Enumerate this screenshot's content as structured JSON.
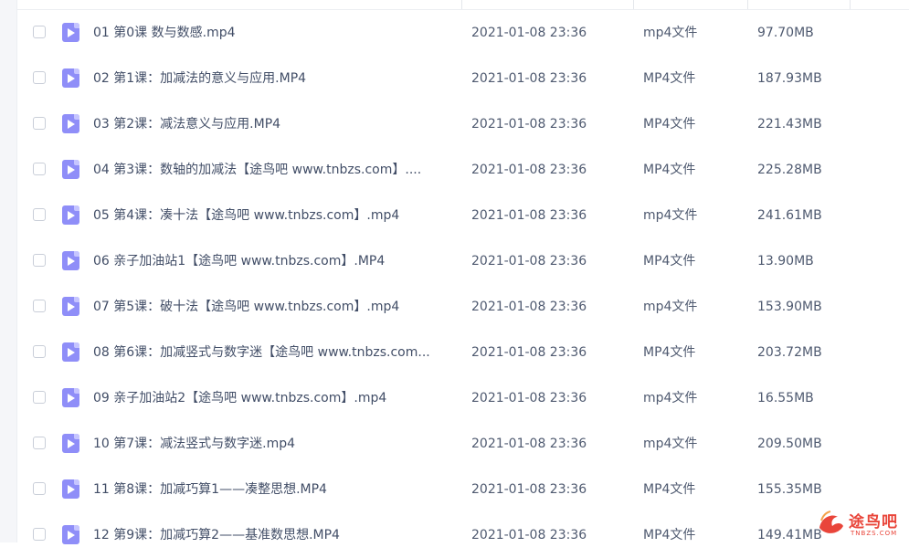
{
  "files": [
    {
      "name": "01 第0课 数与数感.mp4",
      "date": "2021-01-08 23:36",
      "type": "mp4文件",
      "size": "97.70MB"
    },
    {
      "name": "02 第1课：加减法的意义与应用.MP4",
      "date": "2021-01-08 23:36",
      "type": "MP4文件",
      "size": "187.93MB"
    },
    {
      "name": "03 第2课：减法意义与应用.MP4",
      "date": "2021-01-08 23:36",
      "type": "MP4文件",
      "size": "221.43MB"
    },
    {
      "name": "04 第3课：数轴的加减法【途鸟吧 www.tnbzs.com】....",
      "date": "2021-01-08 23:36",
      "type": "MP4文件",
      "size": "225.28MB"
    },
    {
      "name": "05 第4课：凑十法【途鸟吧 www.tnbzs.com】.mp4",
      "date": "2021-01-08 23:36",
      "type": "mp4文件",
      "size": "241.61MB"
    },
    {
      "name": "06 亲子加油站1【途鸟吧 www.tnbzs.com】.MP4",
      "date": "2021-01-08 23:36",
      "type": "MP4文件",
      "size": "13.90MB"
    },
    {
      "name": "07 第5课：破十法【途鸟吧 www.tnbzs.com】.mp4",
      "date": "2021-01-08 23:36",
      "type": "mp4文件",
      "size": "153.90MB"
    },
    {
      "name": "08 第6课：加减竖式与数字迷【途鸟吧 www.tnbzs.com...",
      "date": "2021-01-08 23:36",
      "type": "MP4文件",
      "size": "203.72MB"
    },
    {
      "name": "09 亲子加油站2【途鸟吧 www.tnbzs.com】.mp4",
      "date": "2021-01-08 23:36",
      "type": "mp4文件",
      "size": "16.55MB"
    },
    {
      "name": "10 第7课：减法竖式与数字迷.mp4",
      "date": "2021-01-08 23:36",
      "type": "mp4文件",
      "size": "209.50MB"
    },
    {
      "name": "11 第8课：加减巧算1——凑整思想.MP4",
      "date": "2021-01-08 23:36",
      "type": "MP4文件",
      "size": "155.35MB"
    },
    {
      "name": "12 第9课：加减巧算2——基准数思想.MP4",
      "date": "2021-01-08 23:36",
      "type": "MP4文件",
      "size": "149.41MB"
    }
  ],
  "watermark": {
    "title": "途鸟吧",
    "subtitle": "TNBZS.COM"
  },
  "colors": {
    "file_icon": "#8f8ef8",
    "text": "#424e67",
    "watermark": "#e9453a"
  },
  "icons": {
    "file": "video-file-icon",
    "watermark": "bird-logo-icon"
  }
}
